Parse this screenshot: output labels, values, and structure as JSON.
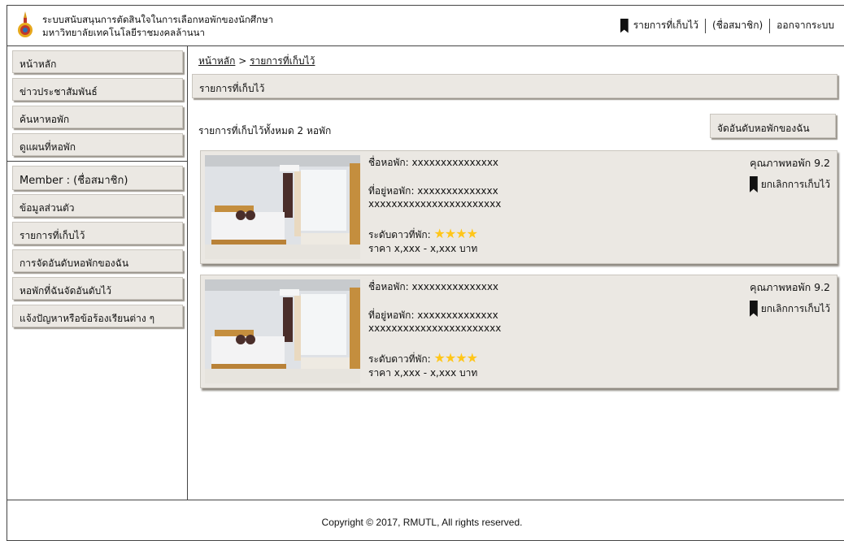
{
  "header": {
    "title_line1": "ระบบสนับสนุนการตัดสินใจในการเลือกหอพักของนักศึกษา",
    "title_line2": "มหาวิทยาลัยเทคโนโลยีราชมงคลล้านนา",
    "nav": {
      "saved": "รายการที่เก็บไว้",
      "member": "(ชื่อสมาชิก)",
      "logout": "ออกจากระบบ"
    }
  },
  "sidebar": {
    "items": [
      {
        "label": "หน้าหลัก"
      },
      {
        "label": "ข่าวประชาสัมพันธ์"
      },
      {
        "label": "ค้นหาหอพัก"
      },
      {
        "label": "ดูแผนที่หอพัก"
      }
    ],
    "member_items": [
      {
        "label": "Member : (ชื่อสมาชิก)"
      },
      {
        "label": "ข้อมูลส่วนตัว"
      },
      {
        "label": "รายการที่เก็บไว้"
      },
      {
        "label": "การจัดอันดับหอพักของฉัน"
      },
      {
        "label": "หอพักที่ฉันจัดอันดับไว้"
      },
      {
        "label": "แจ้งปัญหาหรือข้อร้องเรียนต่าง ๆ"
      }
    ]
  },
  "breadcrumb": {
    "home": "หน้าหลัก",
    "separator": " > ",
    "current": "รายการที่เก็บไว้"
  },
  "main": {
    "section_title": "รายการที่เก็บไว้",
    "count_text": "รายการที่เก็บไว้ทั้งหมด 2 หอพัก",
    "rank_button": "จัดอันดับหอพักของฉัน"
  },
  "cards": [
    {
      "name": "ชื่อหอพัก: xxxxxxxxxxxxxxx",
      "address_line1": "ที่อยู่หอพัก: xxxxxxxxxxxxxx",
      "address_line2": "xxxxxxxxxxxxxxxxxxxxxxx",
      "stars_label": "ระดับดาวที่พัก:",
      "stars": "★★★★",
      "price": "ราคา x,xxx - x,xxx บาท",
      "quality": "คุณภาพหอพัก 9.2",
      "unsave": "ยกเลิกการเก็บไว้"
    },
    {
      "name": "ชื่อหอพัก: xxxxxxxxxxxxxxx",
      "address_line1": "ที่อยู่หอพัก: xxxxxxxxxxxxxx",
      "address_line2": "xxxxxxxxxxxxxxxxxxxxxxx",
      "stars_label": "ระดับดาวที่พัก:",
      "stars": "★★★★",
      "price": "ราคา x,xxx - x,xxx บาท",
      "quality": "คุณภาพหอพัก 9.2",
      "unsave": "ยกเลิกการเก็บไว้"
    }
  ],
  "footer": {
    "copyright": "Copyright © 2017, RMUTL, All rights reserved."
  },
  "colors": {
    "panel": "#ebe8e3",
    "star": "#ffc61a",
    "border": "#444444"
  },
  "icons": [
    "university-logo-icon",
    "bookmark-icon"
  ]
}
